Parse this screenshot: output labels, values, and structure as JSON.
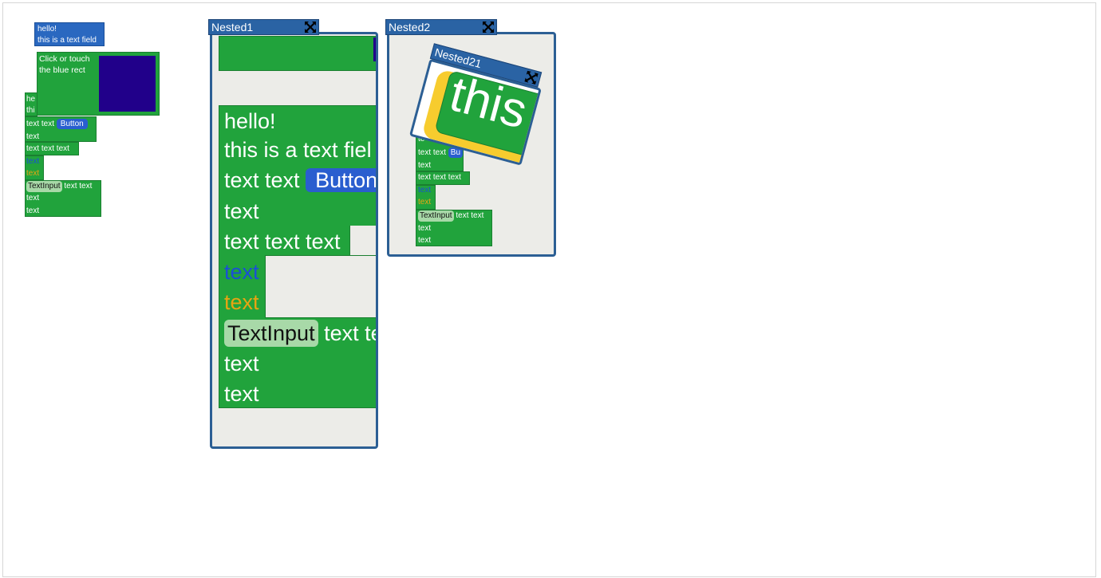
{
  "small": {
    "text_field": [
      "hello!",
      "this is a text field"
    ],
    "click_prompt": [
      "Click or touch",
      "the blue rect"
    ],
    "partial_lines": [
      "he",
      "thi"
    ],
    "row_text_text": "text text",
    "button": "Button",
    "line_text": "text",
    "line_text3": "text text text",
    "line_blue": "text",
    "line_orange": "text",
    "text_input": "TextInput",
    "after_input": "text text",
    "last1": "text",
    "last2": "text"
  },
  "nested1": {
    "title": "Nested1",
    "hello": "hello!",
    "field": "this is a text fiel",
    "row_text_text": "text text",
    "button": "Button",
    "line_text": "text",
    "line_text3": "text text text",
    "line_blue": "text",
    "line_orange": "text",
    "text_input": "TextInput",
    "after_input": "text te",
    "last1": "text",
    "last2": "text"
  },
  "nested2": {
    "title": "Nested2",
    "inner_title": "Nested21",
    "big_word": "this",
    "partial": "te",
    "row_text_text": "text text",
    "button": "Bu",
    "line_text": "text",
    "line_text3": "text text text",
    "line_blue": "text",
    "line_orange": "text",
    "text_input": "TextInput",
    "after_input": "text text",
    "last1": "text",
    "last2": "text"
  },
  "colors": {
    "green": "#21a33c",
    "window_border": "#2c5f94",
    "title_bar": "#2a63a4",
    "dark_rect": "#21008a",
    "blue_text": "#1a4fd6",
    "orange_text": "#e8a412",
    "yellow_frame": "#f7cc2e"
  }
}
